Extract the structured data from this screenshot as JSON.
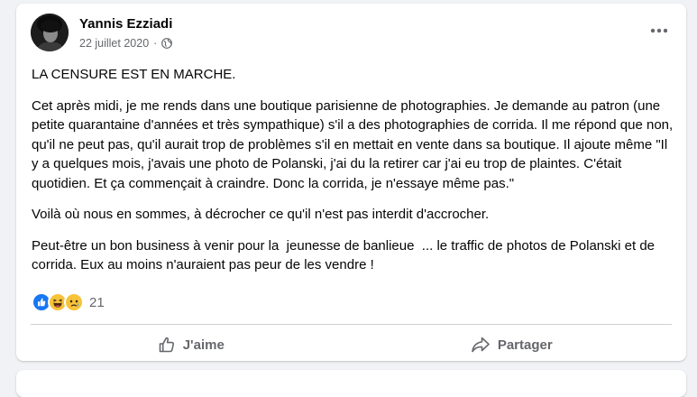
{
  "post": {
    "author": "Yannis Ezziadi",
    "date": "22 juillet 2020",
    "date_separator": "·",
    "privacy_icon": "globe-icon",
    "more_icon": "more-options-icon",
    "paragraphs": [
      "LA CENSURE EST EN MARCHE.",
      "Cet après midi, je me rends dans une boutique parisienne de photographies. Je demande au patron (une petite quarantaine d'années et très sympathique) s'il a des photographies de corrida. Il me répond que non, qu'il ne peut pas, qu'il aurait trop de problèmes s'il en mettait en vente dans sa boutique. Il ajoute même \"Il y a quelques mois, j'avais une photo de Polanski, j'ai du la retirer car j'ai eu trop de plaintes. C'était quotidien. Et ça commençait à craindre. Donc la corrida, je n'essaye même pas.\"",
      "Voilà où nous en sommes, à décrocher ce qu'il n'est pas interdit d'accrocher.",
      "Peut-être un bon business à venir pour la  jeunesse de banlieue  ... le traffic de photos de Polanski et de corrida. Eux au moins n'auraient pas peur de les vendre !"
    ],
    "reactions": {
      "icons": [
        "like-icon",
        "haha-icon",
        "sad-icon"
      ],
      "count": "21"
    },
    "actions": {
      "like_label": "J'aime",
      "share_label": "Partager"
    }
  },
  "colors": {
    "background": "#f0f2f5",
    "card": "#ffffff",
    "primary_text": "#050505",
    "secondary_text": "#65676b",
    "like_blue": "#1877f2",
    "emoji_yellow": "#f7c33a"
  }
}
